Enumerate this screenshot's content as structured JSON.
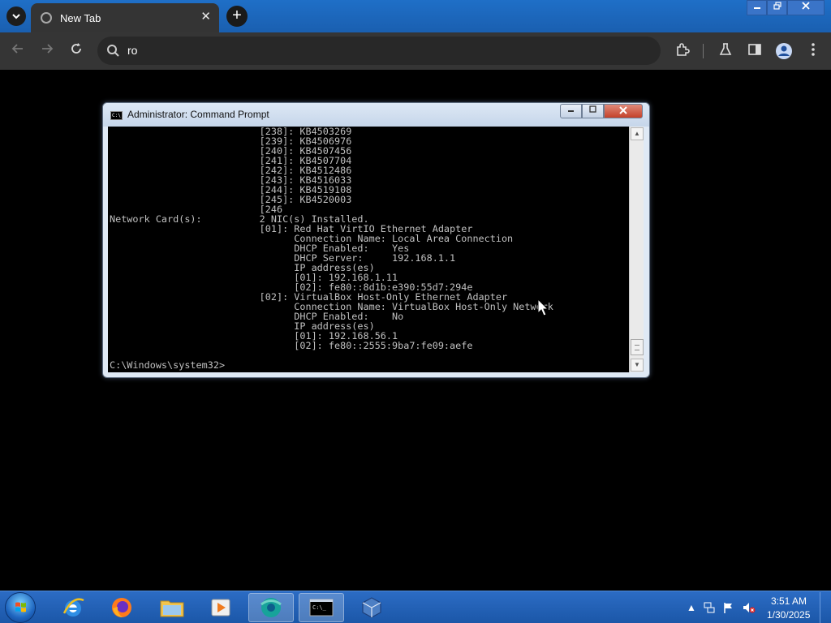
{
  "browser": {
    "tab": {
      "title": "New Tab"
    },
    "omnibox": {
      "value": "ro"
    }
  },
  "cmd": {
    "title": "Administrator: Command Prompt",
    "lines": [
      "                          [238]: KB4503269",
      "                          [239]: KB4506976",
      "                          [240]: KB4507456",
      "                          [241]: KB4507704",
      "                          [242]: KB4512486",
      "                          [243]: KB4516033",
      "                          [244]: KB4519108",
      "                          [245]: KB4520003",
      "                          [246",
      "Network Card(s):          2 NIC(s) Installed.",
      "                          [01]: Red Hat VirtIO Ethernet Adapter",
      "                                Connection Name: Local Area Connection",
      "                                DHCP Enabled:    Yes",
      "                                DHCP Server:     192.168.1.1",
      "                                IP address(es)",
      "                                [01]: 192.168.1.11",
      "                                [02]: fe80::8d1b:e390:55d7:294e",
      "                          [02]: VirtualBox Host-Only Ethernet Adapter",
      "                                Connection Name: VirtualBox Host-Only Network",
      "                                DHCP Enabled:    No",
      "                                IP address(es)",
      "                                [01]: 192.168.56.1",
      "                                [02]: fe80::2555:9ba7:fe09:aefe",
      "",
      "C:\\Windows\\system32>"
    ]
  },
  "taskbar": {
    "clock_time": "3:51 AM",
    "clock_date": "1/30/2025",
    "apps": [
      "internet-explorer",
      "firefox",
      "windows-explorer",
      "media-player",
      "chrome",
      "command-prompt",
      "virtualbox"
    ]
  },
  "colors": {
    "console_text": "#c0c0c0",
    "console_bg": "#000000",
    "taskbar": "#1b57a8",
    "chrome_toolbar": "#353535"
  }
}
